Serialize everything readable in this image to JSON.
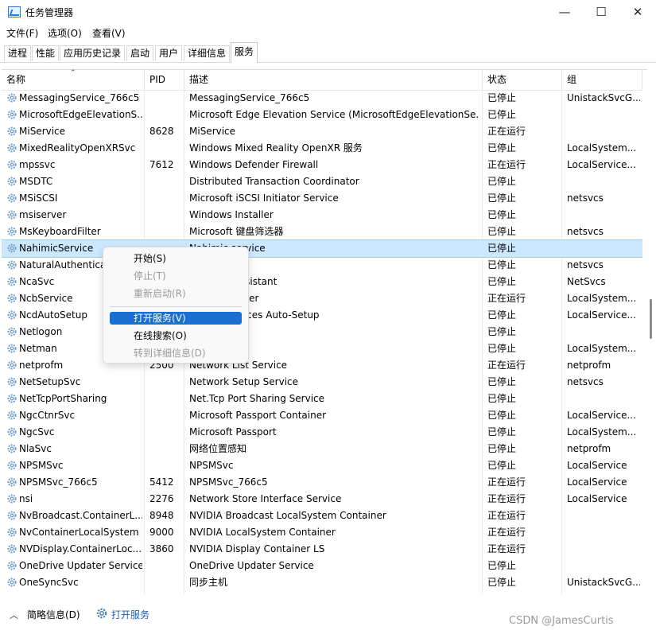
{
  "window": {
    "title": "任务管理器",
    "minimize": "—",
    "maximize": "☐",
    "close": "✕"
  },
  "menu": [
    "文件(F)",
    "选项(O)",
    "查看(V)"
  ],
  "tabs": [
    "进程",
    "性能",
    "应用历史记录",
    "启动",
    "用户",
    "详细信息",
    "服务"
  ],
  "columns": {
    "name": "名称",
    "pid": "PID",
    "desc": "描述",
    "status": "状态",
    "group": "组"
  },
  "rows": [
    {
      "name": "MessagingService_766c5",
      "pid": "",
      "desc": "MessagingService_766c5",
      "status": "已停止",
      "group": "UnistackSvcG..."
    },
    {
      "name": "MicrosoftEdgeElevationS...",
      "pid": "",
      "desc": "Microsoft Edge Elevation Service (MicrosoftEdgeElevationSe...",
      "status": "已停止",
      "group": ""
    },
    {
      "name": "MiService",
      "pid": "8628",
      "desc": "MiService",
      "status": "正在运行",
      "group": ""
    },
    {
      "name": "MixedRealityOpenXRSvc",
      "pid": "",
      "desc": "Windows Mixed Reality OpenXR 服务",
      "status": "已停止",
      "group": "LocalSystem..."
    },
    {
      "name": "mpssvc",
      "pid": "7612",
      "desc": "Windows Defender Firewall",
      "status": "正在运行",
      "group": "LocalService..."
    },
    {
      "name": "MSDTC",
      "pid": "",
      "desc": "Distributed Transaction Coordinator",
      "status": "已停止",
      "group": ""
    },
    {
      "name": "MSiSCSI",
      "pid": "",
      "desc": "Microsoft iSCSI Initiator Service",
      "status": "已停止",
      "group": "netsvcs"
    },
    {
      "name": "msiserver",
      "pid": "",
      "desc": "Windows Installer",
      "status": "已停止",
      "group": ""
    },
    {
      "name": "MsKeyboardFilter",
      "pid": "",
      "desc": "Microsoft 键盘筛选器",
      "status": "已停止",
      "group": "netsvcs"
    },
    {
      "name": "NahimicService",
      "pid": "",
      "desc": "Nahimic service",
      "status": "已停止",
      "group": ""
    },
    {
      "name": "NaturalAuthentication",
      "pid": "",
      "desc": "",
      "status": "已停止",
      "group": "netsvcs"
    },
    {
      "name": "NcaSvc",
      "pid": "",
      "desc": "nectivity Assistant",
      "status": "已停止",
      "group": "NetSvcs"
    },
    {
      "name": "NcbService",
      "pid": "",
      "desc": "nection Broker",
      "status": "正在运行",
      "group": "LocalSystem..."
    },
    {
      "name": "NcdAutoSetup",
      "pid": "",
      "desc": "nected Devices Auto-Setup",
      "status": "已停止",
      "group": "LocalService..."
    },
    {
      "name": "Netlogon",
      "pid": "",
      "desc": "",
      "status": "已停止",
      "group": ""
    },
    {
      "name": "Netman",
      "pid": "",
      "desc": "nections",
      "status": "已停止",
      "group": "LocalSystem..."
    },
    {
      "name": "netprofm",
      "pid": "2500",
      "desc": "Network List Service",
      "status": "正在运行",
      "group": "netprofm"
    },
    {
      "name": "NetSetupSvc",
      "pid": "",
      "desc": "Network Setup Service",
      "status": "已停止",
      "group": "netsvcs"
    },
    {
      "name": "NetTcpPortSharing",
      "pid": "",
      "desc": "Net.Tcp Port Sharing Service",
      "status": "已停止",
      "group": ""
    },
    {
      "name": "NgcCtnrSvc",
      "pid": "",
      "desc": "Microsoft Passport Container",
      "status": "已停止",
      "group": "LocalService..."
    },
    {
      "name": "NgcSvc",
      "pid": "",
      "desc": "Microsoft Passport",
      "status": "已停止",
      "group": "LocalSystem..."
    },
    {
      "name": "NlaSvc",
      "pid": "",
      "desc": "网络位置感知",
      "status": "已停止",
      "group": "netprofm"
    },
    {
      "name": "NPSMSvc",
      "pid": "",
      "desc": "NPSMSvc",
      "status": "已停止",
      "group": "LocalService"
    },
    {
      "name": "NPSMSvc_766c5",
      "pid": "5412",
      "desc": "NPSMSvc_766c5",
      "status": "正在运行",
      "group": "LocalService"
    },
    {
      "name": "nsi",
      "pid": "2276",
      "desc": "Network Store Interface Service",
      "status": "正在运行",
      "group": "LocalService"
    },
    {
      "name": "NvBroadcast.ContainerL...",
      "pid": "8948",
      "desc": "NVIDIA Broadcast LocalSystem Container",
      "status": "正在运行",
      "group": ""
    },
    {
      "name": "NvContainerLocalSystem",
      "pid": "9000",
      "desc": "NVIDIA LocalSystem Container",
      "status": "正在运行",
      "group": ""
    },
    {
      "name": "NVDisplay.ContainerLoc...",
      "pid": "3860",
      "desc": "NVIDIA Display Container LS",
      "status": "正在运行",
      "group": ""
    },
    {
      "name": "OneDrive Updater Service",
      "pid": "",
      "desc": "OneDrive Updater Service",
      "status": "已停止",
      "group": ""
    },
    {
      "name": "OneSyncSvc",
      "pid": "",
      "desc": "同步主机",
      "status": "已停止",
      "group": "UnistackSvcG..."
    }
  ],
  "context_menu": [
    {
      "label": "开始(S)",
      "state": "enabled"
    },
    {
      "label": "停止(T)",
      "state": "disabled"
    },
    {
      "label": "重新启动(R)",
      "state": "disabled"
    },
    {
      "label": "打开服务(V)",
      "state": "highlighted"
    },
    {
      "label": "在线搜索(O)",
      "state": "enabled"
    },
    {
      "label": "转到详细信息(D)",
      "state": "disabled"
    }
  ],
  "footer": {
    "brief": "简略信息(D)",
    "open_services": "打开服务"
  },
  "watermark": "CSDN @JamesCurtis",
  "colors": {
    "selection": "#cce8ff",
    "menu_highlight": "#1a6fd1",
    "gear": "#4a7fb3"
  }
}
